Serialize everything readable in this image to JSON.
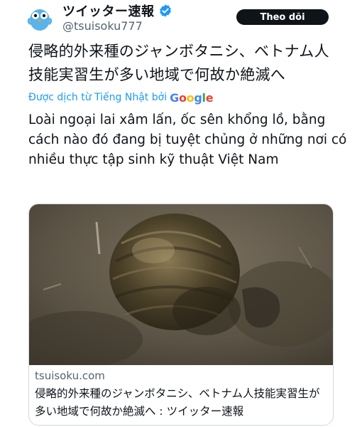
{
  "tweet": {
    "display_name": "ツイッター速報",
    "handle": "@tsuisoku777",
    "follow_label": "Theo dõi",
    "original_text": "侵略的外来種のジャンボタニシ、ベトナム人技能実習生が多い地域で何故か絶滅へ",
    "translated_by_label": "Được dịch từ Tiếng Nhật bởi",
    "translator_brand": "Google",
    "translated_text": "Loài ngoại lai xâm lấn, ốc sên khổng lồ, bằng cách nào đó đang bị tuyệt chủng ở những nơi có nhiều thực tập sinh kỹ thuật Việt Nam"
  },
  "link_card": {
    "domain": "tsuisoku.com",
    "title": "侵略的外来種のジャンボタニシ、ベトナム人技能実習生が多い地域で何故か絶滅へ : ツイッター速報"
  },
  "colors": {
    "text": "#0f1419",
    "muted": "#536471",
    "link": "#1d9bf0",
    "verified": "#1d9bf0",
    "button_bg": "#0f1419",
    "border": "#cfd9de"
  },
  "icons": {
    "avatar": "bird-avatar-icon",
    "verified": "verified-badge-icon",
    "google": "google-logo"
  }
}
